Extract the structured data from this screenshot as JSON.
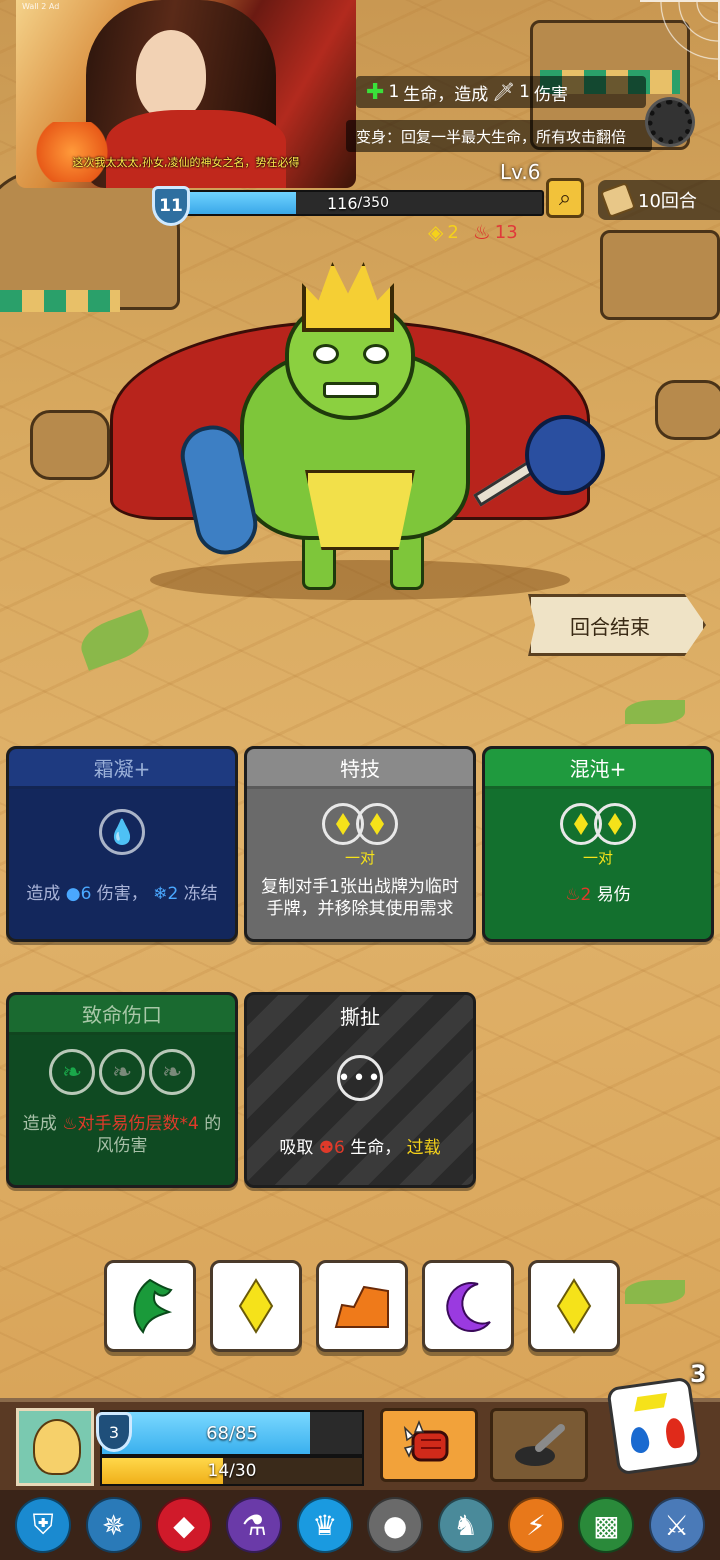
{
  "ad_banner": {
    "tiny_label": "Wall 2 Ad",
    "caption": "这次我太太太,孙女,凌仙的神女之名，势在必得"
  },
  "enemy": {
    "intent": {
      "heal_value": "1",
      "heal_text": "生命，造成",
      "damage_value": "1",
      "damage_text": "伤害"
    },
    "transform_text": "变身：回复一半最大生命，所有攻击翻倍",
    "level": "Lv.6",
    "armor": "11",
    "hp_current": "116",
    "hp_max": " /350",
    "hp_fraction": 0.331,
    "status_yellow": "2",
    "status_red": "13",
    "rounds": "10回合"
  },
  "end_turn_label": "回合结束",
  "cards": [
    {
      "title": "霜凝+",
      "desc_prefix": "造成",
      "desc_num1": "6",
      "desc_mid": "伤害，",
      "desc_num2": "2",
      "desc_suffix": "冻结"
    },
    {
      "title": "特技",
      "slot_label": "一对",
      "desc": "复制对手1张出战牌为临时手牌，并移除其使用需求"
    },
    {
      "title": "混沌+",
      "slot_label": "一对",
      "desc_num": "2",
      "desc_suffix": "易伤"
    },
    {
      "title": "致命伤口",
      "desc_prefix": "造成",
      "desc_red": "对手易伤层数*4",
      "desc_suffix": "的风伤害"
    },
    {
      "title": "撕扯",
      "desc_prefix": "吸取",
      "desc_num": "6",
      "desc_mid": "生命，",
      "desc_yellow": "过载"
    }
  ],
  "dice": [
    {
      "icon": "wind-icon",
      "color": "#1a9a3a"
    },
    {
      "icon": "diamond-icon",
      "color": "#f5e21a"
    },
    {
      "icon": "earth-icon",
      "color": "#ef7a1a"
    },
    {
      "icon": "moon-icon",
      "color": "#9a3ae0"
    },
    {
      "icon": "diamond-icon",
      "color": "#f5e21a"
    }
  ],
  "player": {
    "armor": "3",
    "hp_text": "68/85",
    "hp_fraction": 0.8,
    "energy_text": "14/30",
    "energy_fraction": 0.467,
    "dice_remaining": "3"
  },
  "relics": [
    {
      "icon": "shield-relic-icon",
      "color": "#1a8ad0"
    },
    {
      "icon": "compass-relic-icon",
      "color": "#2a7ab8"
    },
    {
      "icon": "ruby-relic-icon",
      "color": "#d01a2a"
    },
    {
      "icon": "potion-relic-icon",
      "color": "#6a3aa8"
    },
    {
      "icon": "crown-relic-icon",
      "color": "#1a9ae0"
    },
    {
      "icon": "rock-relic-icon",
      "color": "#6a6a6a"
    },
    {
      "icon": "beast-relic-icon",
      "color": "#4a8a9a"
    },
    {
      "icon": "lightning-relic-icon",
      "color": "#e8781a"
    },
    {
      "icon": "slime-relic-icon",
      "color": "#2a8a3a"
    },
    {
      "icon": "sword-relic-icon",
      "color": "#4a7ab8"
    }
  ]
}
